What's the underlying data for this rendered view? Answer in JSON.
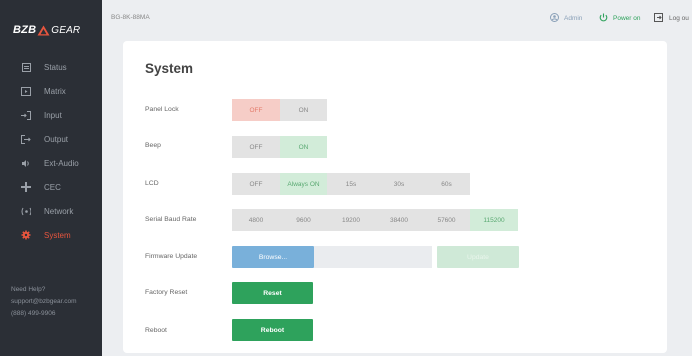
{
  "brand": {
    "logo_left": "BZB",
    "logo_right": "GEAR",
    "accent": "#e8553e"
  },
  "sidebar": {
    "items": [
      {
        "label": "Status",
        "icon": "status-icon"
      },
      {
        "label": "Matrix",
        "icon": "matrix-icon"
      },
      {
        "label": "Input",
        "icon": "input-icon"
      },
      {
        "label": "Output",
        "icon": "output-icon"
      },
      {
        "label": "Ext-Audio",
        "icon": "speaker-icon"
      },
      {
        "label": "CEC",
        "icon": "cec-icon"
      },
      {
        "label": "Network",
        "icon": "network-icon"
      },
      {
        "label": "System",
        "icon": "gear-icon",
        "active": true
      }
    ],
    "help": {
      "title": "Need Help?",
      "email": "support@bzbgear.com",
      "phone": "(888) 499-9906"
    }
  },
  "header": {
    "model": "BG-8K-88MA",
    "user": "Admin",
    "power": "Power on",
    "logout": "Log ou"
  },
  "main": {
    "title": "System",
    "panel_lock": {
      "label": "Panel Lock",
      "options": [
        "OFF",
        "ON"
      ],
      "selected": "OFF"
    },
    "beep": {
      "label": "Beep",
      "options": [
        "OFF",
        "ON"
      ],
      "selected": "ON"
    },
    "lcd": {
      "label": "LCD",
      "options": [
        "OFF",
        "Always ON",
        "15s",
        "30s",
        "60s"
      ],
      "selected": "Always ON"
    },
    "baud": {
      "label": "Serial Baud Rate",
      "options": [
        "4800",
        "9600",
        "19200",
        "38400",
        "57600",
        "115200"
      ],
      "selected": "115200"
    },
    "firmware": {
      "label": "Firmware Update",
      "browse": "Browse...",
      "file_value": "",
      "update": "Update"
    },
    "factory_reset": {
      "label": "Factory Reset",
      "button": "Reset"
    },
    "reboot": {
      "label": "Reboot",
      "button": "Reboot"
    }
  },
  "colors": {
    "green": "#2ea25c",
    "selected_green_bg": "#d2ecd9",
    "selected_red_bg": "#f6cdc7",
    "browse_blue": "#79b0da"
  }
}
